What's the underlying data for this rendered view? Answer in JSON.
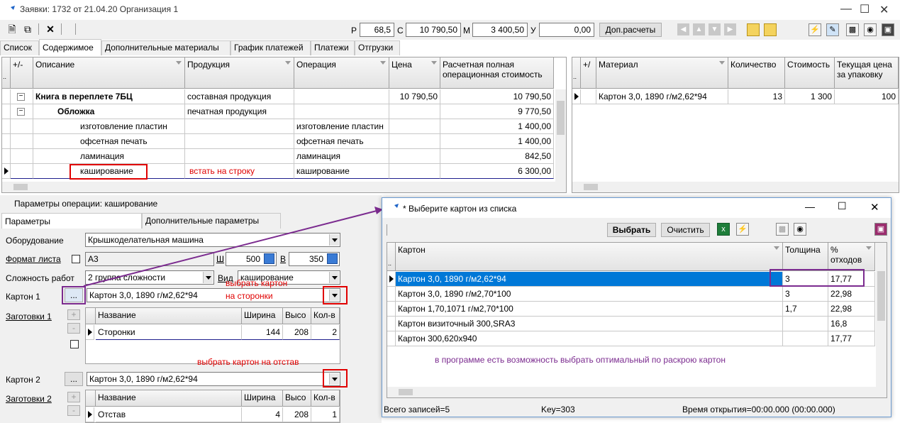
{
  "window": {
    "title": "Заявки: 1732 от 21.04.20  Организация 1"
  },
  "toolbar": {
    "r_label": "Р",
    "r_value": "68,5",
    "c_label": "С",
    "c_value": "10 790,50",
    "m_label": "М",
    "m_value": "3 400,50",
    "u_label": "У",
    "u_value": "0,00",
    "extra_button": "Доп.расчеты"
  },
  "tabs": [
    "Список",
    "Содержимое",
    "Дополнительные материалы",
    "График платежей",
    "Платежи",
    "Отгрузки"
  ],
  "main_grid": {
    "headers": {
      "pm": "+/-",
      "desc": "Описание",
      "prod": "Продукция",
      "oper": "Операция",
      "price": "Цена",
      "cost_a": "Расчетная полная",
      "cost_b": "операционная стоимость"
    },
    "rows": [
      {
        "desc": "Книга в переплете 7БЦ",
        "prod": "составная продукция",
        "oper": "",
        "price": "10 790,50",
        "cost": "10 790,50"
      },
      {
        "desc": "Обложка",
        "prod": "печатная продукция",
        "oper": "",
        "price": "",
        "cost": "9 770,50"
      },
      {
        "desc": "изготовление пластин",
        "prod": "",
        "oper": "изготовление пластин",
        "price": "",
        "cost": "1 400,00"
      },
      {
        "desc": "офсетная печать",
        "prod": "",
        "oper": "офсетная печать",
        "price": "",
        "cost": "1 400,00"
      },
      {
        "desc": "ламинация",
        "prod": "",
        "oper": "ламинация",
        "price": "",
        "cost": "842,50"
      },
      {
        "desc": "каширование",
        "prod": "",
        "oper": "каширование",
        "price": "",
        "cost": "6 300,00"
      }
    ],
    "annotation": "встать на строку"
  },
  "mat_grid": {
    "headers": {
      "pm": "+/",
      "mat": "Материал",
      "qty": "Количество",
      "cost": "Стоимость",
      "cur_a": "Текущая цена",
      "cur_b": "за упаковку"
    },
    "rows": [
      {
        "mat": "Картон 3,0, 1890 г/м2,62*94",
        "qty": "13",
        "cost": "1 300",
        "cur": "100"
      }
    ]
  },
  "params": {
    "title": "Параметры операции: каширование",
    "tab1": "Параметры",
    "tab2": "Дополнительные параметры",
    "equip_label": "Оборудование",
    "equip_value": "Крышкоделательная машина",
    "format_label": "Формат листа",
    "format_value": "A3",
    "w_label": "Ш",
    "w_value": "500",
    "h_label": "В",
    "h_value": "350",
    "complex_label": "Сложность работ",
    "complex_value": "2 группа сложности",
    "vid_label": "Вид",
    "vid_value": "каширование",
    "karton1_label": "Картон 1",
    "karton1_value": "Картон 3,0, 1890 г/м2,62*94",
    "dots": "...",
    "zag1_label": "Заготовки 1",
    "sub_headers": {
      "name": "Название",
      "w": "Ширина",
      "h": "Высо",
      "q": "Кол-в"
    },
    "zag1_row": {
      "name": "Сторонки",
      "w": "144",
      "h": "208",
      "q": "2"
    },
    "karton2_label": "Картон 2",
    "karton2_value": "Картон 3,0, 1890 г/м2,62*94",
    "zag2_label": "Заготовки 2",
    "zag2_row": {
      "name": "Отстав",
      "w": "4",
      "h": "208",
      "q": "1"
    },
    "note1a": "выбрать картон",
    "note1b": "на сторонки",
    "note2": "выбрать картон на отстав",
    "plus": "+",
    "minus": "-"
  },
  "dialog": {
    "title": "* Выберите картон из списка",
    "select_btn": "Выбрать",
    "clear_btn": "Очистить",
    "headers": {
      "name": "Картон",
      "thick": "Толщина",
      "waste_a": "%",
      "waste_b": "отходов"
    },
    "rows": [
      {
        "name": "Картон 3,0, 1890 г/м2,62*94",
        "thick": "3",
        "waste": "17,77"
      },
      {
        "name": "Картон 3,0, 1890 г/м2,70*100",
        "thick": "3",
        "waste": "22,98"
      },
      {
        "name": "Картон 1,70,1071 г/м2,70*100",
        "thick": "1,7",
        "waste": "22,98"
      },
      {
        "name": "Картон визиточный 300,SRA3",
        "thick": "",
        "waste": "16,8"
      },
      {
        "name": "Картон 300,620x940",
        "thick": "",
        "waste": "17,77"
      }
    ],
    "note": "в программе есть возможность выбрать оптимальный по раскрою картон",
    "status_total": "Всего записей=5",
    "status_key": "Key=303",
    "status_time": "Время открытия=00:00.000 (00:00.000)"
  },
  "colors": {
    "accent": "#0078d7",
    "annotation_red": "#e00000",
    "annotation_purple": "#7b2b8f"
  }
}
